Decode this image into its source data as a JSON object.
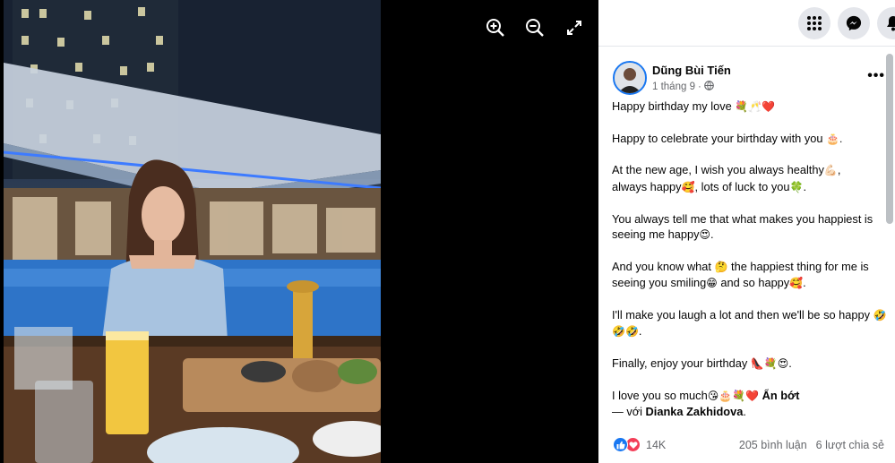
{
  "viewer": {
    "tools": [
      "zoom-in-icon",
      "zoom-out-icon",
      "fullscreen-icon"
    ]
  },
  "topnav": {
    "icons": [
      "menu-grid-icon",
      "messenger-icon",
      "notifications-icon"
    ]
  },
  "post": {
    "author": "Dũng Bùi Tiến",
    "date": "1 tháng 9",
    "dot": "·",
    "more": "•••",
    "lines": [
      {
        "text": "Happy birthday my love ",
        "emoji": "💐🥂❤️"
      },
      {
        "text": "Happy to celebrate your birthday with you ",
        "emoji": "🎂."
      },
      {
        "text": "At the new age, I wish you always healthy",
        "emoji": "💪🏻",
        "text2": ",",
        "text3": "always happy",
        "emoji2": "🥰",
        "text4": ", lots of luck to you",
        "emoji3": "🍀",
        "text5": "."
      },
      {
        "text": "You always tell me that what makes you happiest is seeing me happy",
        "emoji": "😍",
        "text2": "."
      },
      {
        "text": "And you know what ",
        "emoji": "🤔",
        "text2": " the happiest thing for me is seeing you smiling",
        "emoji2": "😁",
        "text3": " and so happy",
        "emoji3": "🥰",
        "text4": "."
      },
      {
        "text": "I'll make you laugh a lot and then we'll be so happy ",
        "emoji": "🤣🤣🤣",
        "text2": "."
      },
      {
        "text": "Finally, enjoy your birthday ",
        "emoji": "👠💐😍",
        "text2": "."
      },
      {
        "text": "I love you so much",
        "emoji": "😘🎂💐❤️",
        "seemore": " Ẩn bớt"
      }
    ],
    "with_prefix": "— với ",
    "with_name": "Dianka Zakhidova",
    "with_suffix": "."
  },
  "footer": {
    "reactions": [
      "like-icon",
      "love-icon"
    ],
    "count": "14K",
    "comments": "205 bình luận",
    "shares": "6 lượt chia sẻ"
  },
  "colors": {
    "accent": "#1877f2",
    "love": "#f33e58",
    "secondary_text": "#65676b"
  }
}
